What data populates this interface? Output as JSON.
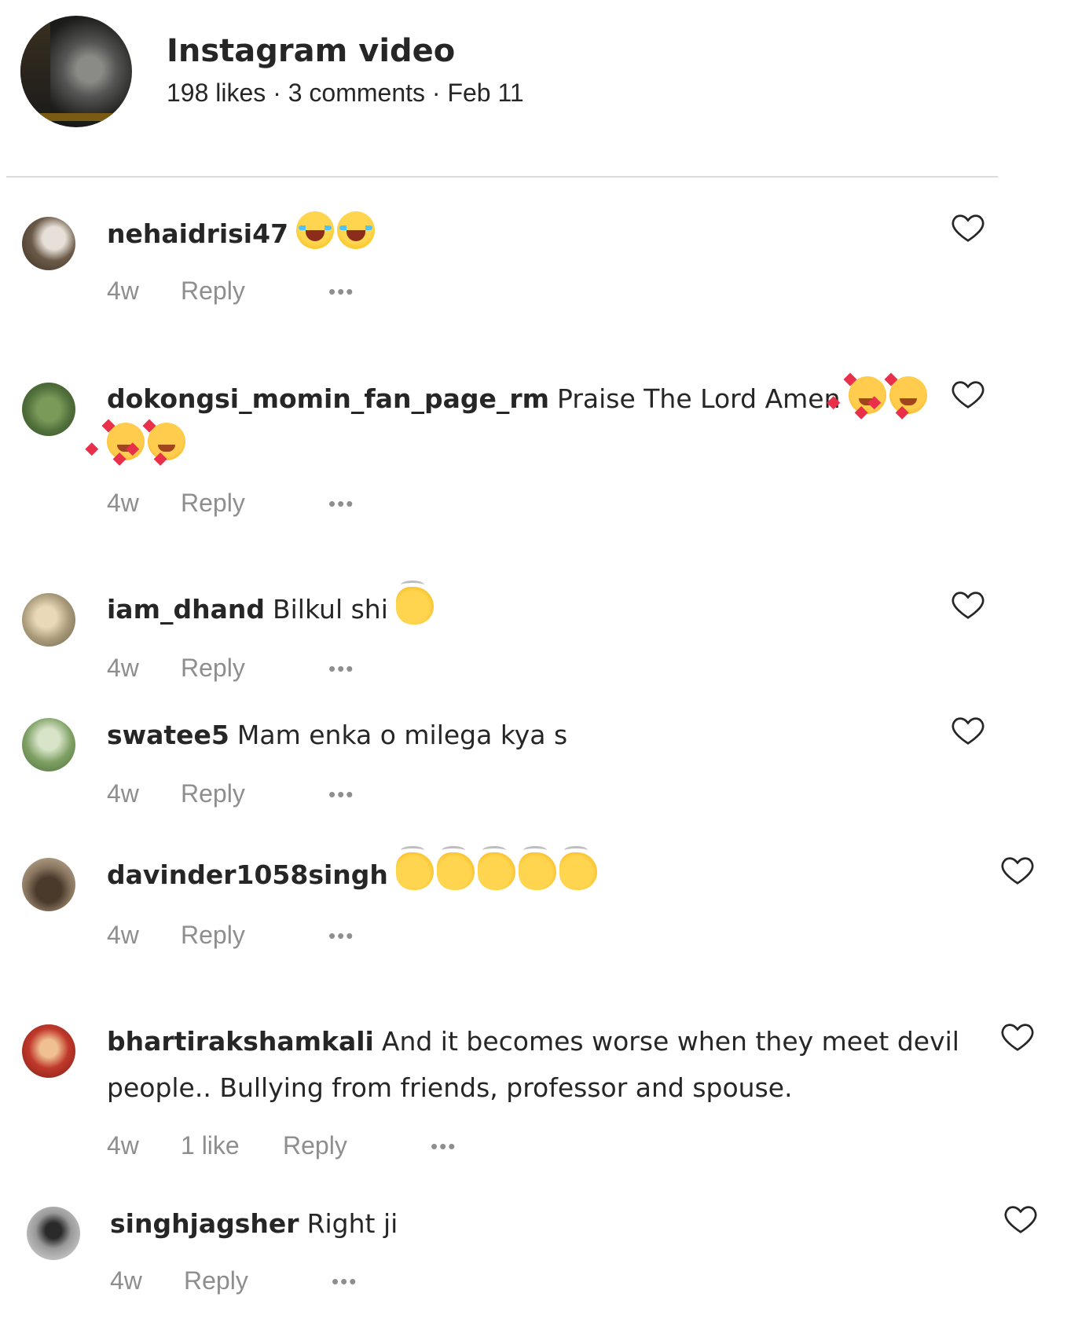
{
  "post": {
    "title": "Instagram video",
    "meta": "198 likes · 3 comments · Feb 11"
  },
  "comments": [
    {
      "username": "nehaidrisi47",
      "text": "",
      "time": "4w",
      "likes": "",
      "reply": "Reply",
      "emoji": [
        "laugh-cry-emoji",
        "laugh-cry-emoji"
      ]
    },
    {
      "username": "dokongsi_momin_fan_page_rm",
      "text": "Praise The Lord Amen",
      "time": "4w",
      "likes": "",
      "reply": "Reply",
      "emoji": [
        "smiling-hearts-emoji",
        "smiling-hearts-emoji",
        "smiling-hearts-emoji",
        "smiling-hearts-emoji"
      ]
    },
    {
      "username": "iam_dhand",
      "text": "Bilkul shi",
      "time": "4w",
      "likes": "",
      "reply": "Reply",
      "emoji": [
        "clapping-hands-emoji"
      ]
    },
    {
      "username": "swatee5",
      "text": "Mam enka o milega kya s",
      "time": "4w",
      "likes": "",
      "reply": "Reply",
      "emoji": []
    },
    {
      "username": "davinder1058singh",
      "text": "",
      "time": "4w",
      "likes": "",
      "reply": "Reply",
      "emoji": [
        "clapping-hands-emoji",
        "clapping-hands-emoji",
        "clapping-hands-emoji",
        "clapping-hands-emoji",
        "clapping-hands-emoji"
      ]
    },
    {
      "username": "bhartirakshamkali",
      "text": "And it becomes worse when they meet devil people.. Bullying from friends, professor and spouse.",
      "time": "4w",
      "likes": "1 like",
      "reply": "Reply",
      "emoji": []
    },
    {
      "username": "singhjagsher",
      "text": "Right ji",
      "time": "4w",
      "likes": "",
      "reply": "Reply",
      "emoji": []
    }
  ],
  "icons": {
    "like": "heart-outline-icon",
    "more": "more-horizontal-icon"
  },
  "colors": {
    "text": "#262626",
    "secondary": "#8e8e8e",
    "divider": "#dbdbdb"
  }
}
